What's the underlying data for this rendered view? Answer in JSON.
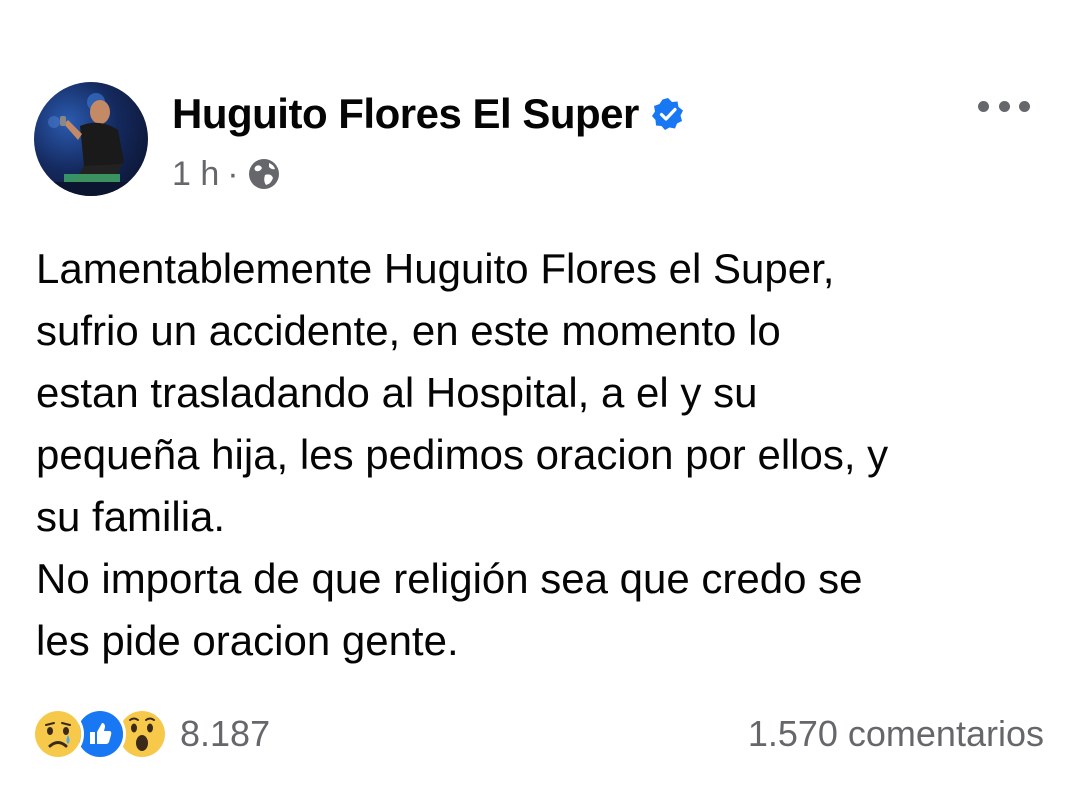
{
  "post": {
    "author": "Huguito Flores El Super",
    "verified": true,
    "time": "1 h",
    "separator": "·",
    "audience_icon": "globe-icon",
    "more_icon": "more-options-icon",
    "text_lines": [
      "Lamentablemente Huguito Flores el Super,",
      "sufrio un accidente, en este momento lo",
      "estan trasladando al Hospital, a el y su",
      "pequeña hija, les pedimos oracion por ellos, y",
      "su familia.",
      "No importa de que religión sea que credo se",
      "les pide oracion gente."
    ]
  },
  "reactions": {
    "icons": [
      "sad-reaction-icon",
      "like-reaction-icon",
      "wow-reaction-icon"
    ],
    "count": "8.187"
  },
  "comments": {
    "label": "1.570 comentarios"
  },
  "colors": {
    "verified_blue": "#1877f2",
    "secondary_text": "#65676b",
    "primary_text": "#050505",
    "top_strip": "#c9ccd1"
  }
}
